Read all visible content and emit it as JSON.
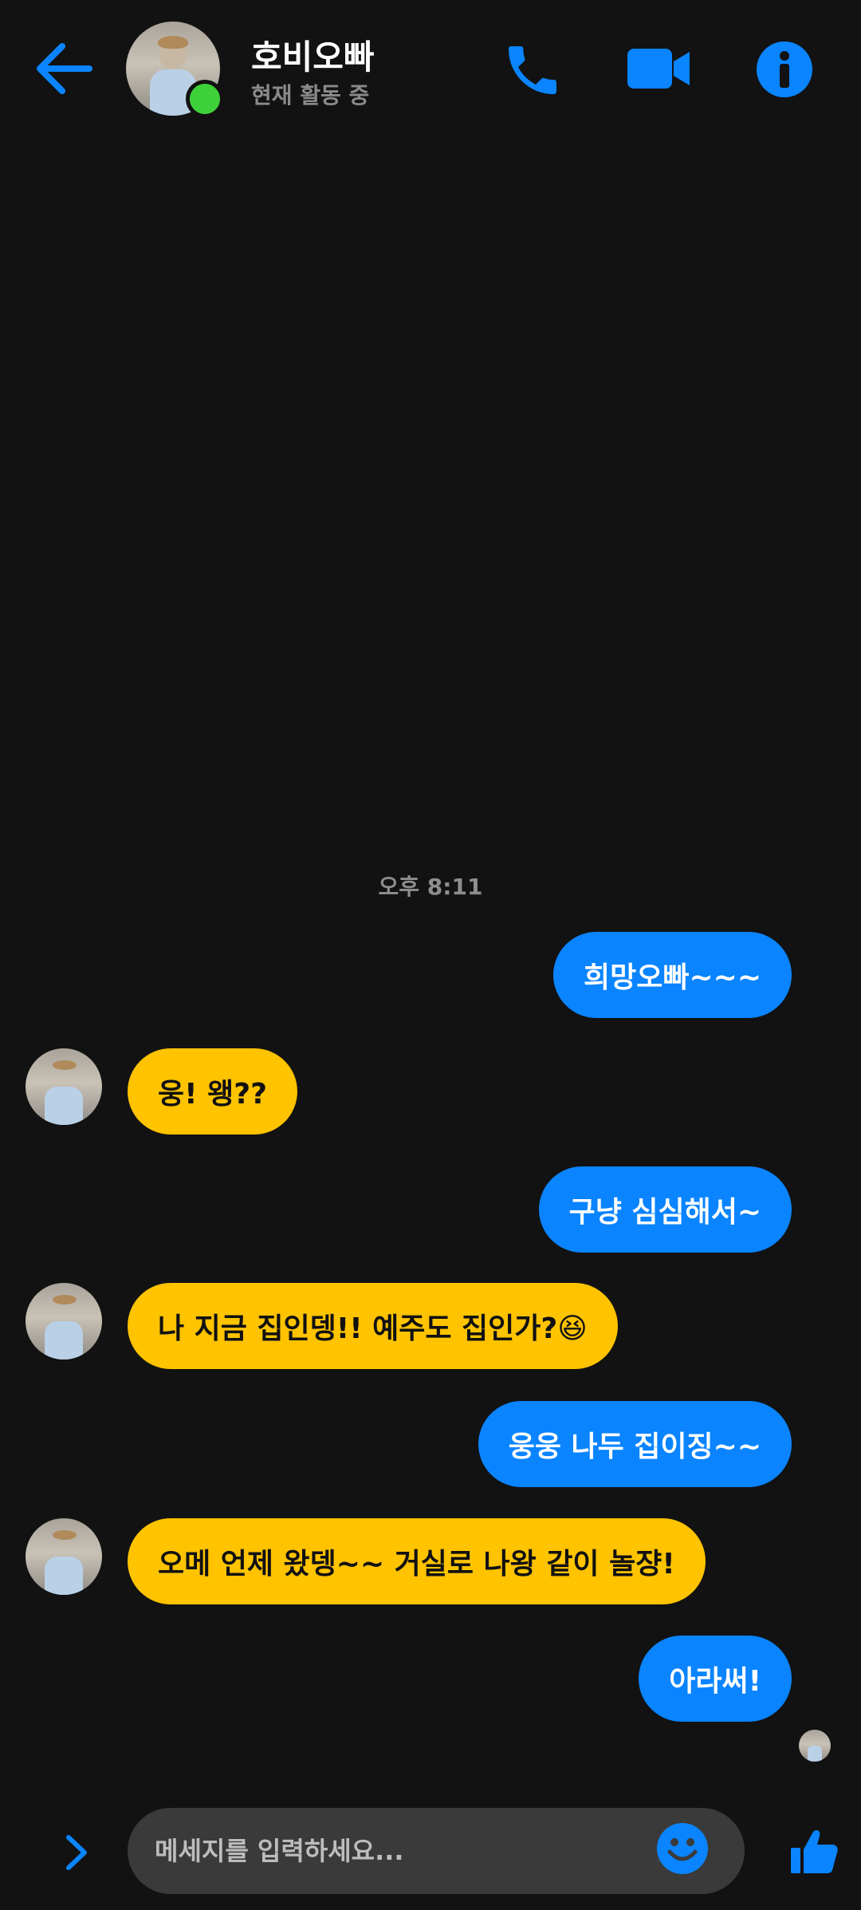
{
  "header": {
    "contact_name": "호비오빠",
    "status": "현재 활동 중"
  },
  "conversation": {
    "timestamp": "오후 8:11",
    "messages": [
      {
        "direction": "sent",
        "text": "희망오빠~~~"
      },
      {
        "direction": "received",
        "text": "웅! 왱??"
      },
      {
        "direction": "sent",
        "text": "구냥 심심해서~"
      },
      {
        "direction": "received",
        "text": "나 지금 집인뎅!! 예주도 집인가?😆"
      },
      {
        "direction": "sent",
        "text": "웅웅 나두 집이징~~"
      },
      {
        "direction": "received",
        "text": "오메 언제 왔뎅~~ 거실로 나왕 같이 놀쟝!"
      },
      {
        "direction": "sent",
        "text": "아라써!"
      }
    ]
  },
  "composer": {
    "placeholder": "메세지를 입력하세요..."
  },
  "icons": {
    "back": "arrow-left-icon",
    "call": "phone-icon",
    "video": "video-camera-icon",
    "info": "info-icon",
    "expand": "chevron-right-icon",
    "emoji": "smiley-icon",
    "like": "thumbs-up-icon"
  },
  "colors": {
    "accent": "#0a84ff",
    "sent_bubble": "#0a84ff",
    "received_bubble": "#ffc300",
    "online": "#3fd13a",
    "background": "#121212"
  }
}
